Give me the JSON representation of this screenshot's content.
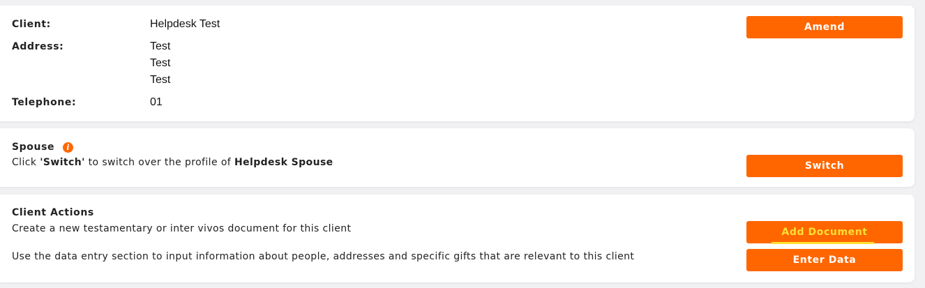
{
  "client_card": {
    "client_label": "Client:",
    "client_value": "Helpdesk Test",
    "address_label": "Address:",
    "address_lines": [
      "Test",
      "Test",
      "Test"
    ],
    "telephone_label": "Telephone:",
    "telephone_value": "01",
    "amend_label": "Amend"
  },
  "spouse_card": {
    "title": "Spouse",
    "text_prefix": "Click ",
    "text_switch": "'Switch'",
    "text_middle": " to switch over the profile of ",
    "spouse_name": "Helpdesk Spouse",
    "switch_label": "Switch",
    "info_icon": "info-icon"
  },
  "actions_card": {
    "title": "Client Actions",
    "add_document_text": "Create a new testamentary or inter vivos document for this client",
    "data_entry_text": "Use the data entry section to input information about people, addresses and specific gifts that are relevant to this client",
    "add_document_label": "Add Document",
    "enter_data_label": "Enter Data"
  },
  "colors": {
    "accent": "#ff6600",
    "highlight_text": "#ffe033",
    "background": "#f1f1f3",
    "card": "#ffffff"
  }
}
